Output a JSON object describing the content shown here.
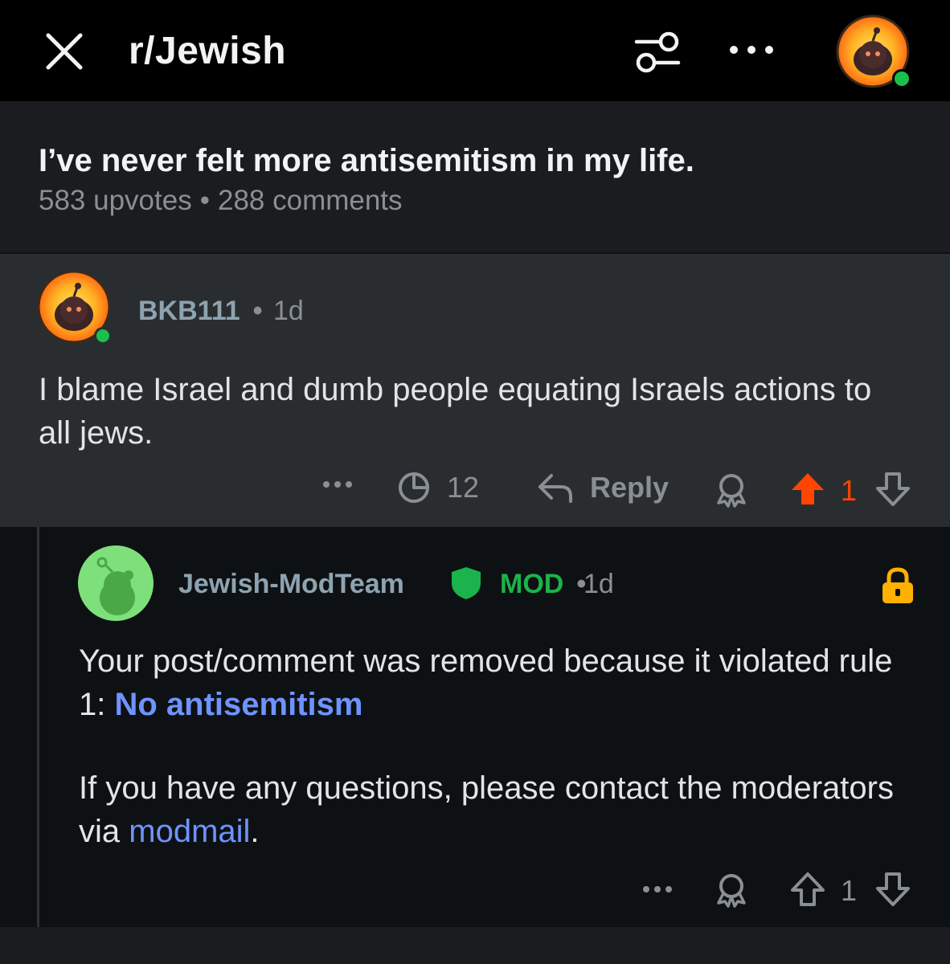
{
  "topbar": {
    "subreddit": "r/Jewish",
    "icons": [
      "close-icon",
      "sort-icon",
      "more-icon",
      "avatar"
    ]
  },
  "post": {
    "title": "I’ve never felt more antisemitism in my life.",
    "upvotes": "583 upvotes",
    "separator": "•",
    "comments": "288 comments"
  },
  "comment1": {
    "username": "BKB111",
    "separator": "•",
    "time": "1d",
    "body": "I blame Israel and dumb people equating Israels actions to all jews.",
    "replies_count": "12",
    "reply_label": "Reply",
    "vote_count": "1",
    "upvoted": true,
    "upvote_color": "#ff4500"
  },
  "comment2": {
    "username": "Jewish-ModTeam",
    "mod_label": "MOD",
    "separator": "•",
    "time": "1d",
    "line1_prefix": "Your post/comment was removed because it violated rule 1: ",
    "rule_link": "No antisemitism",
    "line2_prefix": "If you have any questions, please contact the moderators via ",
    "modmail_link": "modmail",
    "line2_suffix": ".",
    "vote_count": "1",
    "mod_color": "#1bb34b",
    "lock_color": "#ffb000",
    "link_color": "#6f93ff"
  }
}
